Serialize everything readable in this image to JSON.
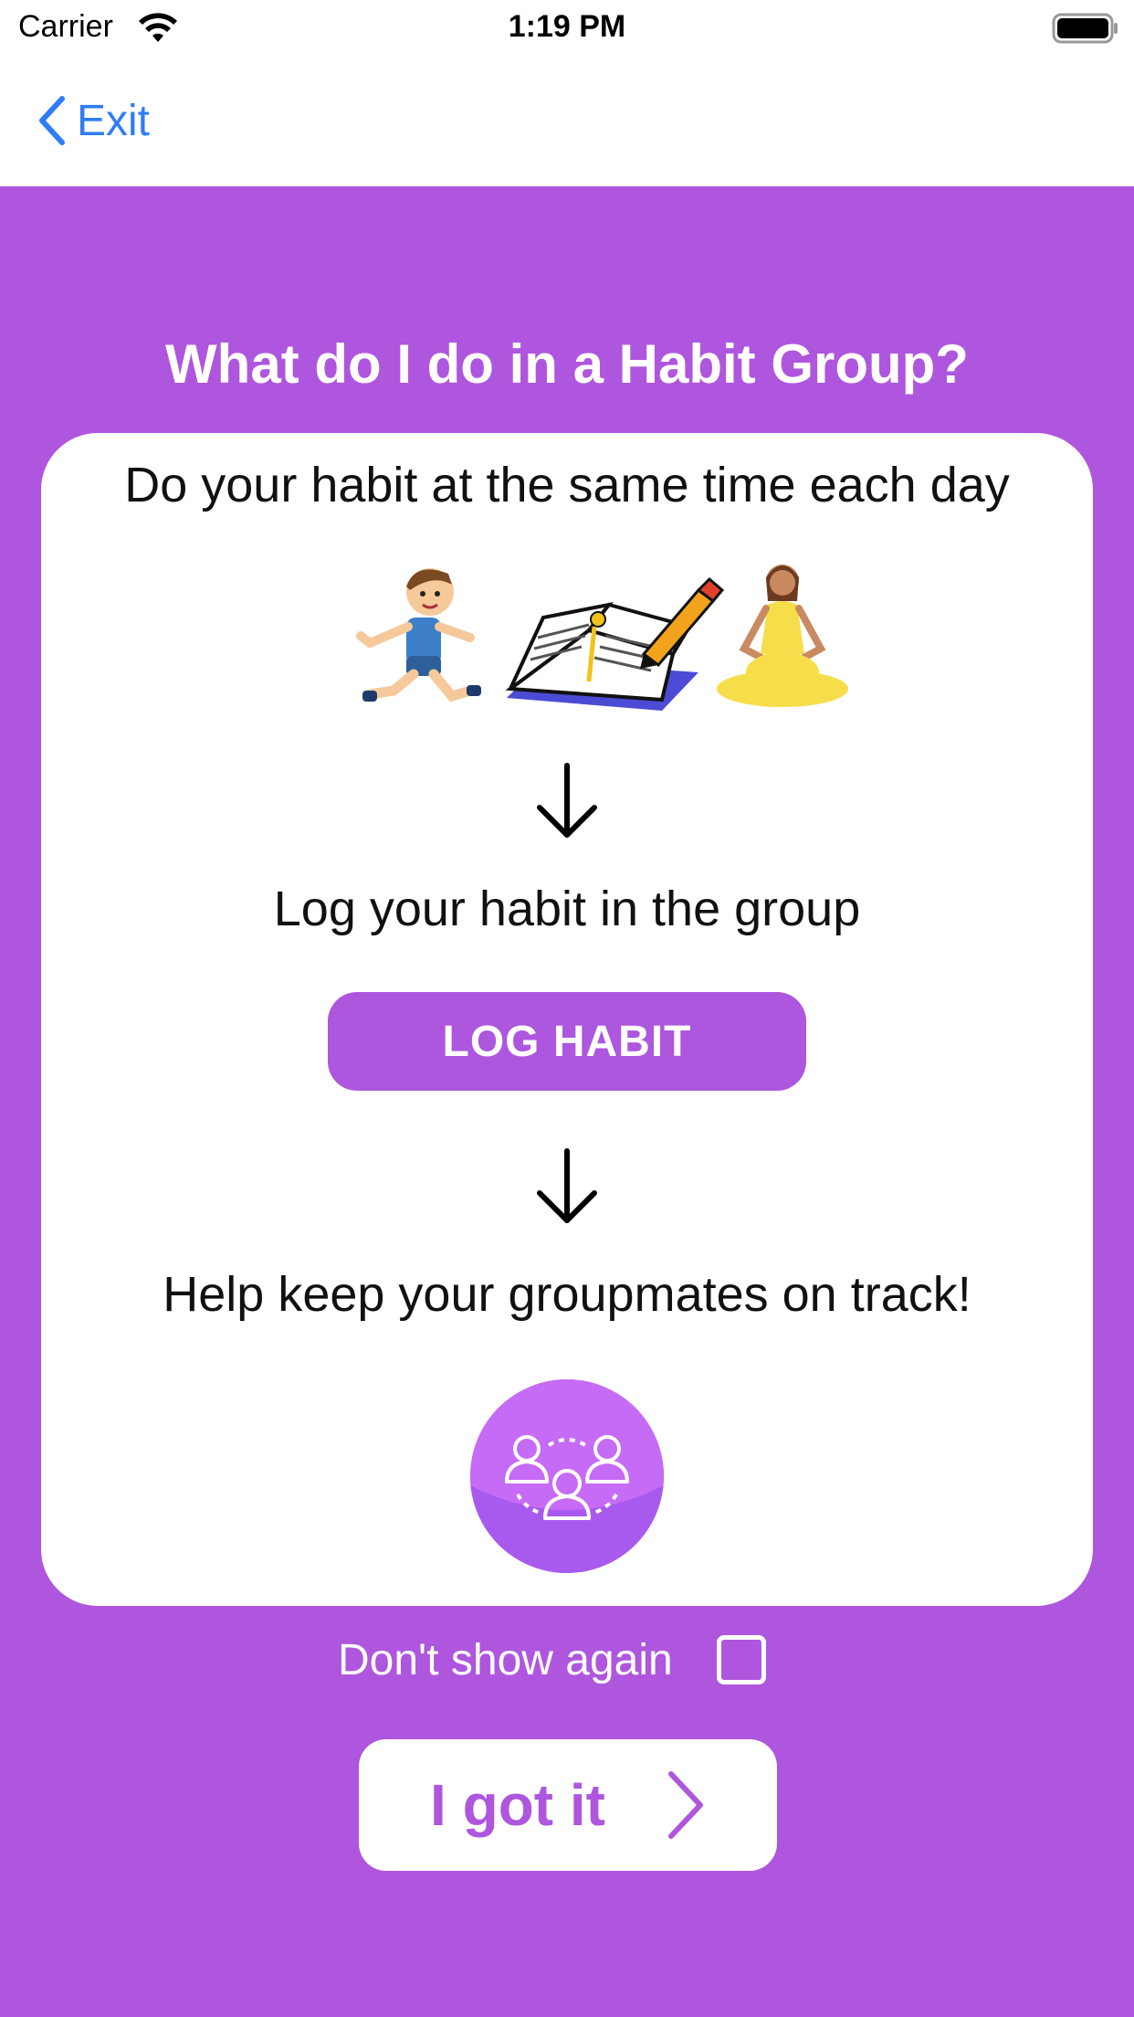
{
  "status_bar": {
    "carrier": "Carrier",
    "time": "1:19 PM",
    "icons": [
      "wifi-icon",
      "battery-icon"
    ]
  },
  "nav": {
    "back_label": "Exit",
    "back_icon": "chevron-left-icon",
    "accent_color": "#2f7df6"
  },
  "main": {
    "background_color": "#ae56de",
    "heading": "What do I do in a Habit Group?",
    "steps": [
      {
        "text": "Do your habit at the same time each day",
        "illustrations": [
          "running-boy-icon",
          "journal-icon",
          "meditating-woman-icon"
        ]
      },
      {
        "text": "Log your habit in the group",
        "button_label": "LOG HABIT"
      },
      {
        "text": "Help keep your groupmates on track!",
        "icon": "group-people-icon"
      }
    ],
    "dont_show_again_label": "Don't show again",
    "dont_show_again_checked": false,
    "got_it_label": "I got it"
  }
}
